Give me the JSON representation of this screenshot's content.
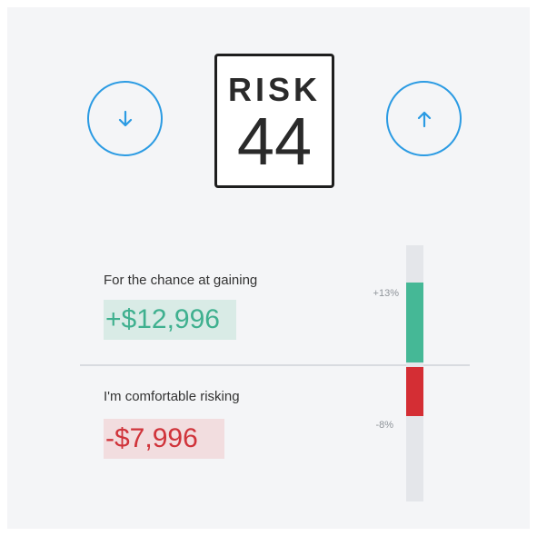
{
  "risk": {
    "label": "RISK",
    "value": "44"
  },
  "controls": {
    "decrease_icon": "arrow-down-icon",
    "increase_icon": "arrow-up-icon",
    "accent_color": "#2b9be3"
  },
  "gain": {
    "caption": "For the chance at gaining",
    "amount": "+$12,996",
    "percent": "+13%",
    "percent_value": 13,
    "color": "#45b896"
  },
  "loss": {
    "caption": "I'm comfortable risking",
    "amount": "-$7,996",
    "percent": "-8%",
    "percent_value": -8,
    "color": "#d42e34"
  }
}
